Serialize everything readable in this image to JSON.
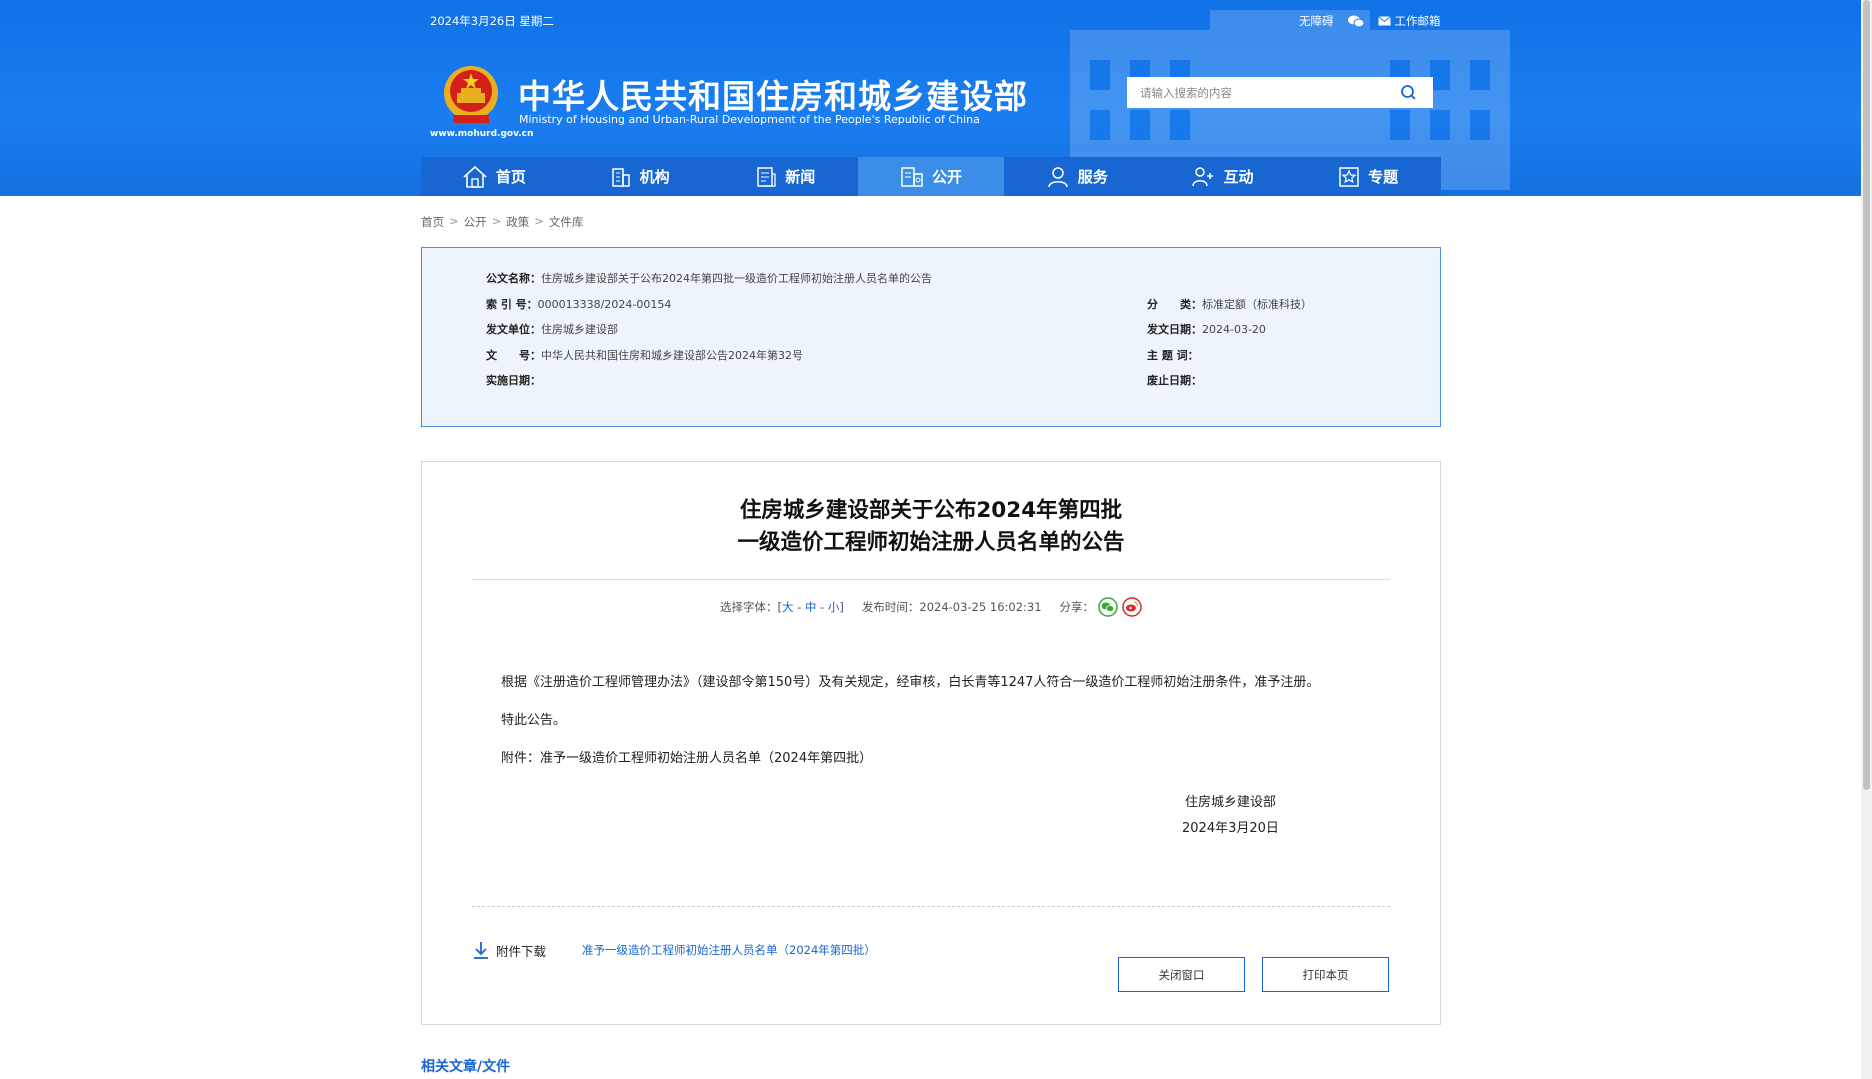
{
  "header": {
    "date": "2024年3月26日 星期二",
    "accessibility": "无障碍",
    "mail": "工作邮箱",
    "title_cn": "中华人民共和国住房和城乡建设部",
    "title_en": "Ministry of Housing and Urban-Rural Development of the People's Republic of China",
    "url": "www.mohurd.gov.cn",
    "search_placeholder": "请输入搜索的内容"
  },
  "nav": {
    "items": [
      {
        "label": "首页",
        "icon": "home-icon"
      },
      {
        "label": "机构",
        "icon": "building-icon"
      },
      {
        "label": "新闻",
        "icon": "news-icon"
      },
      {
        "label": "公开",
        "icon": "open-icon"
      },
      {
        "label": "服务",
        "icon": "service-icon"
      },
      {
        "label": "互动",
        "icon": "interact-icon"
      },
      {
        "label": "专题",
        "icon": "topic-icon"
      }
    ],
    "active": "公开"
  },
  "breadcrumb": [
    "首页",
    "公开",
    "政策",
    "文件库"
  ],
  "meta": {
    "name_label": "公文名称：",
    "name": "住房城乡建设部关于公布2024年第四批一级造价工程师初始注册人员名单的公告",
    "index_label": "索 引 号：",
    "index": "000013338/2024-00154",
    "category_label": "分　　类：",
    "category": "标准定额（标准科技）",
    "issuer_label": "发文单位：",
    "issuer": "住房城乡建设部",
    "date_label": "发文日期：",
    "date": "2024-03-20",
    "docno_label": "文　　号：",
    "docno": "中华人民共和国住房和城乡建设部公告2024年第32号",
    "subject_label": "主 题 词：",
    "subject": "",
    "impl_label": "实施日期：",
    "impl": "",
    "abolish_label": "废止日期：",
    "abolish": ""
  },
  "article": {
    "title_line1": "住房城乡建设部关于公布2024年第四批",
    "title_line2": "一级造价工程师初始注册人员名单的公告",
    "font_label": "选择字体：[",
    "font_large": "大",
    "font_mid": "中",
    "font_small": "小",
    "font_end": "]",
    "publish_time": "发布时间：2024-03-25 16:02:31",
    "share_label": "分享：",
    "para1": "根据《注册造价工程师管理办法》（建设部令第150号）及有关规定，经审核，白长青等1247人符合一级造价工程师初始注册条件，准予注册。",
    "para2": "特此公告。",
    "para3": "附件：准予一级造价工程师初始注册人员名单（2024年第四批）",
    "sign_org": "住房城乡建设部",
    "sign_date": "2024年3月20日",
    "attachment_label": "附件下载",
    "attachment_link": "准予一级造价工程师初始注册人员名单（2024年第四批）",
    "close_btn": "关闭窗口",
    "print_btn": "打印本页"
  },
  "related_title": "相关文章/文件",
  "colors": {
    "brand": "#1766d2",
    "header_bg": "#0f72e6",
    "nav_active": "#3a8ee8"
  }
}
